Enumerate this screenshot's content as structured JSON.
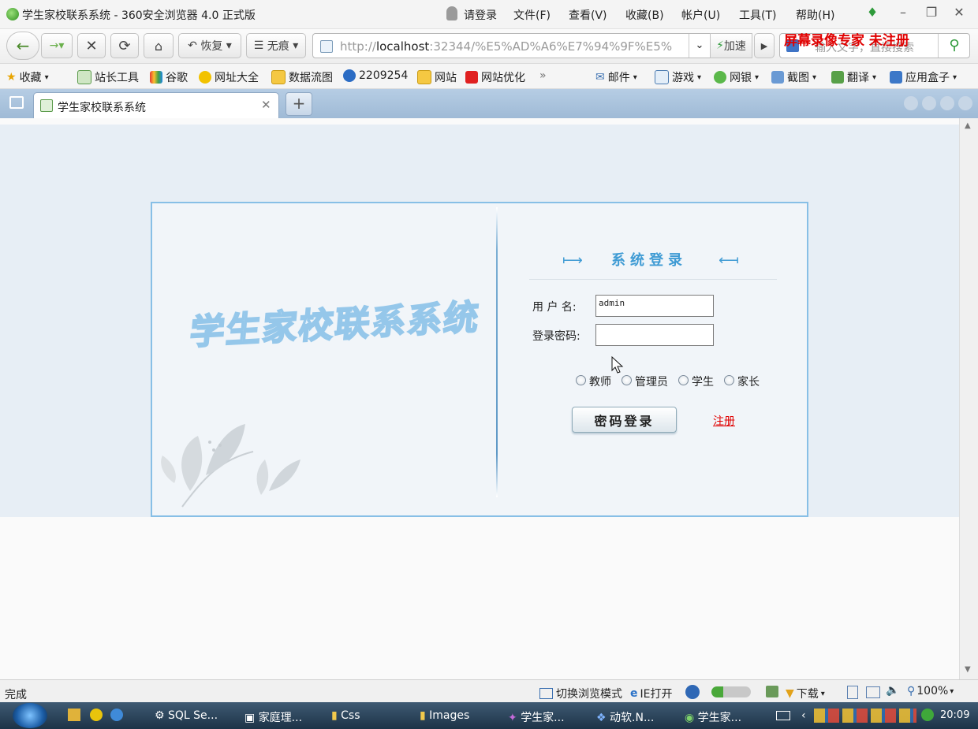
{
  "window": {
    "title": "学生家校联系系统 - 360安全浏览器 4.0 正式版",
    "login_link": "请登录",
    "menu": [
      "文件(F)",
      "查看(V)",
      "收藏(B)",
      "帐户(U)",
      "工具(T)",
      "帮助(H)"
    ]
  },
  "toolbar": {
    "restore_label": "恢复",
    "incognito_label": "无痕",
    "url_prefix": "http://",
    "url_host": "localhost",
    "url_rest": ":32344/%E5%AD%A6%E7%94%9F%E5%",
    "speed_label": "加速",
    "search_placeholder": "输入文字，直接搜索"
  },
  "watermark": "屏幕录像专家  未注册",
  "bookmarks": {
    "favorites": "收藏",
    "items": [
      "站长工具",
      "谷歌",
      "网址大全",
      "数据流图",
      "2209254",
      "网站",
      "网站优化"
    ],
    "more": "»",
    "right": [
      "邮件",
      "游戏",
      "网银",
      "截图",
      "翻译",
      "应用盒子"
    ]
  },
  "tab": {
    "title": "学生家校联系系统"
  },
  "page": {
    "brand": "学生家校联系系统",
    "login_title": "系统登录",
    "username_label": "用 户 名:",
    "username_value": "admin",
    "password_label": "登录密码:",
    "roles": [
      "教师",
      "管理员",
      "学生",
      "家长"
    ],
    "login_button": "密码登录",
    "register_link": "注册"
  },
  "statusbar": {
    "left": "完成",
    "switch_mode": "切换浏览模式",
    "ie_open": "IE打开",
    "download": "下载",
    "zoom": "100%"
  },
  "taskbar": {
    "items": [
      "SQL Se...",
      "家庭理...",
      "Css",
      "Images",
      "学生家...",
      "动软.N...",
      "学生家..."
    ],
    "clock": "20:09"
  },
  "colors": {
    "accent": "#3f9bd4",
    "panel_border": "#87bfe6",
    "register": "#e00000",
    "tabbar": "#a9c3de"
  }
}
